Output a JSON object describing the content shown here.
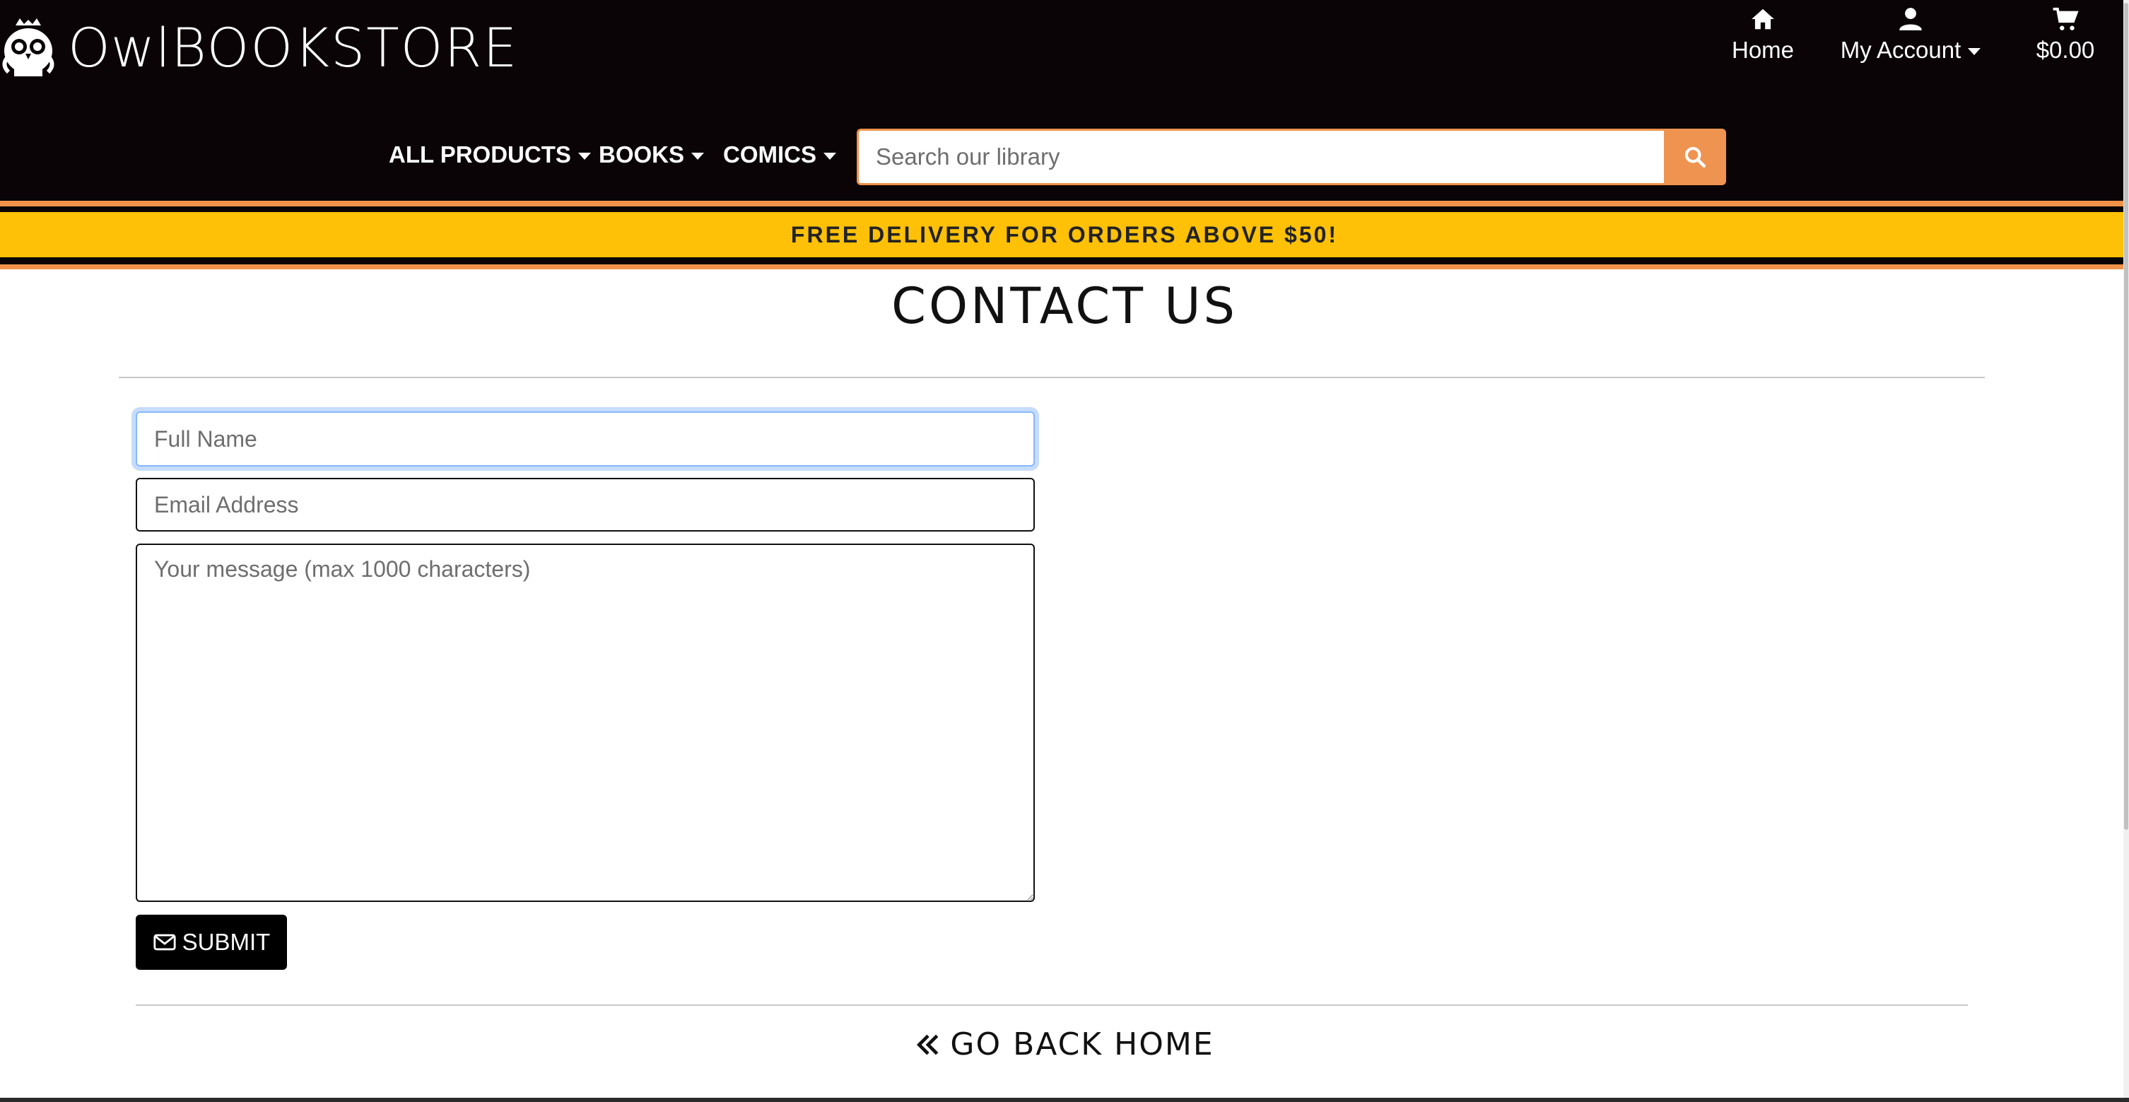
{
  "brand": {
    "name_part1": "Owl",
    "name_part2": "BOOKSTORE"
  },
  "top_nav": {
    "home": {
      "label": "Home",
      "icon": "home-icon"
    },
    "account": {
      "label": "My Account",
      "icon": "user-icon"
    },
    "cart": {
      "label": "$0.00",
      "icon": "cart-icon"
    }
  },
  "main_nav": {
    "items": [
      {
        "label": "ALL PRODUCTS"
      },
      {
        "label": "BOOKS"
      },
      {
        "label": "COMICS"
      }
    ],
    "search": {
      "placeholder": "Search our library",
      "button_icon": "search-icon"
    }
  },
  "promo": {
    "text": "FREE DELIVERY FOR ORDERS ABOVE $50!"
  },
  "page": {
    "title": "CONTACT US"
  },
  "form": {
    "full_name": {
      "placeholder": "Full Name",
      "value": ""
    },
    "email": {
      "placeholder": "Email Address",
      "value": ""
    },
    "message": {
      "placeholder": "Your message (max 1000 characters)",
      "value": ""
    },
    "submit_label": "SUBMIT",
    "submit_icon": "envelope-icon"
  },
  "back_home": {
    "label": "GO BACK HOME",
    "icon": "double-chevron-left-icon"
  },
  "colors": {
    "header_bg": "#0a0406",
    "accent_orange": "#f0924a",
    "promo_yellow": "#ffc107",
    "button_black": "#000000"
  }
}
